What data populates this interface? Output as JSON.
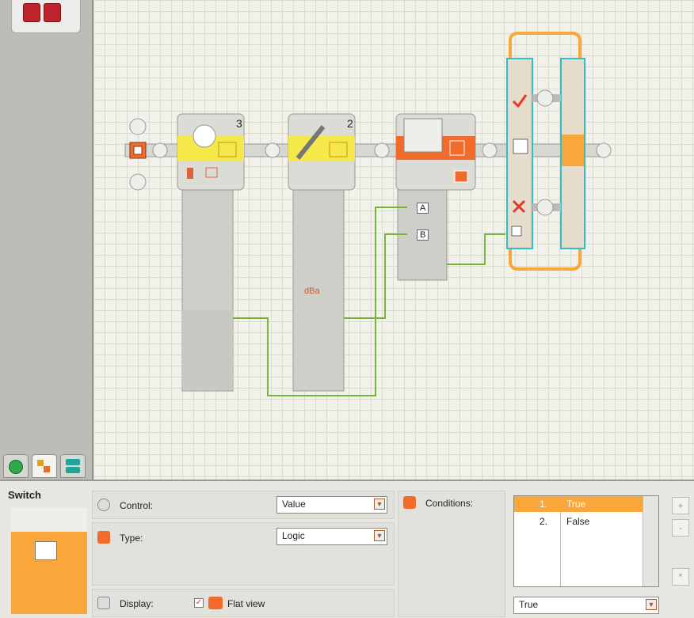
{
  "panel": {
    "title": "Switch",
    "control_label": "Control:",
    "control_value": "Value",
    "type_label": "Type:",
    "type_value": "Logic",
    "display_label": "Display:",
    "flat_view_label": "Flat view",
    "flat_view_checked": true,
    "conditions_label": "Conditions:",
    "conditions": [
      {
        "num": "1.",
        "value": "True",
        "selected": true
      },
      {
        "num": "2.",
        "value": "False",
        "selected": false
      }
    ],
    "condition_value": "True",
    "side_buttons": [
      "+",
      "-",
      "*"
    ]
  },
  "blocks": {
    "light_sensor_port": "3",
    "sound_sensor_port": "2",
    "logic_port_a": "A",
    "logic_port_b": "B",
    "sound_unit": "dBa"
  },
  "colors": {
    "accent_orange": "#f9a73a",
    "block_yellow": "#f4e84a",
    "logic_orange": "#f26b2a",
    "wire_green": "#78b43a",
    "switch_cyan": "#2fbfc6"
  }
}
